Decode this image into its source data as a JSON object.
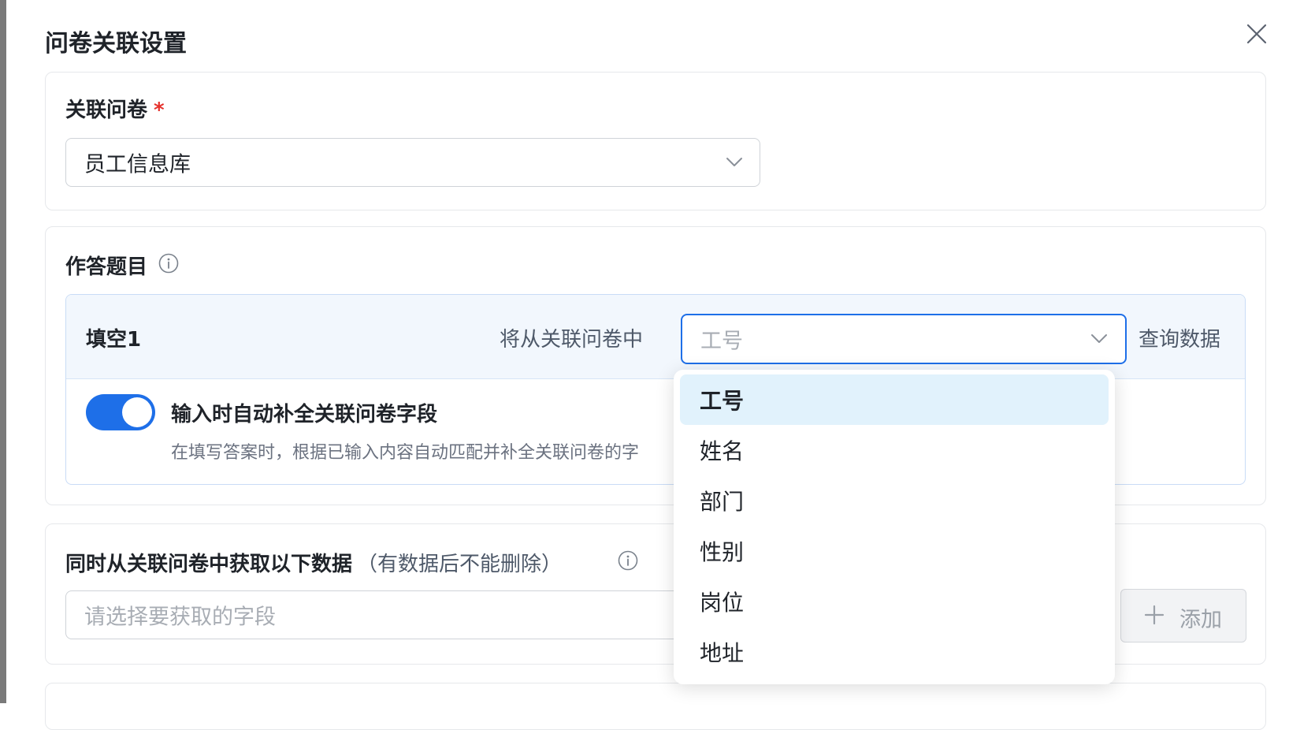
{
  "dialog": {
    "title": "问卷关联设置"
  },
  "linked_survey": {
    "label": "关联问卷",
    "required_mark": "*",
    "selected_value": "员工信息库"
  },
  "answer_questions": {
    "label": "作答题目",
    "question": {
      "name": "填空1",
      "from_text": "将从关联问卷中",
      "field_placeholder": "工号",
      "query_text": "查询数据",
      "autocomplete_toggle": {
        "on": true,
        "label": "输入时自动补全关联问卷字段",
        "description": "在填写答案时，根据已输入内容自动匹配并补全关联问卷的字"
      }
    }
  },
  "fetch_data": {
    "label": "同时从关联问卷中获取以下数据",
    "note": "（有数据后不能删除）",
    "field_placeholder": "请选择要获取的字段",
    "add_button_label": "添加"
  },
  "dropdown": {
    "selected_index": 0,
    "options": [
      "工号",
      "姓名",
      "部门",
      "性别",
      "岗位",
      "地址"
    ]
  },
  "colors": {
    "primary": "#1e6fe8",
    "required": "#e5302b",
    "selected_option_bg": "#e1f2fc",
    "question_header_bg": "#f2f7fd"
  }
}
